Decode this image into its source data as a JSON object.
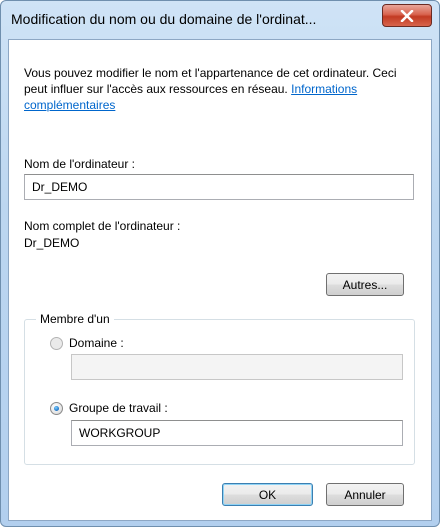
{
  "window": {
    "title": "Modification du nom ou du domaine de l'ordinat..."
  },
  "intro": {
    "text": "Vous pouvez modifier le nom et l'appartenance de cet ordinateur. Ceci peut influer sur l'accès aux ressources en réseau.",
    "link": "Informations complémentaires"
  },
  "computer_name": {
    "label": "Nom de l'ordinateur :",
    "value": "Dr_DEMO"
  },
  "full_name": {
    "label": "Nom complet de l'ordinateur :",
    "value": "Dr_DEMO"
  },
  "buttons": {
    "more": "Autres...",
    "ok": "OK",
    "cancel": "Annuler"
  },
  "membership": {
    "legend": "Membre d'un",
    "domain_label": "Domaine :",
    "domain_value": "",
    "workgroup_label": "Groupe de travail :",
    "workgroup_value": "WORKGROUP",
    "selected": "workgroup"
  }
}
